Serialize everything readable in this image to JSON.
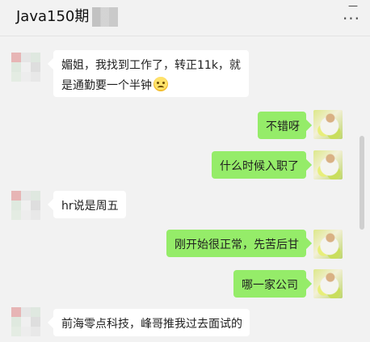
{
  "header": {
    "title": "Java150期",
    "more_label": "···",
    "minimize_label": "—"
  },
  "messages": [
    {
      "side": "left",
      "lines": [
        "媚姐，我找到工作了，转正11k，就",
        "是通勤要一个半钟"
      ],
      "emoji": "crying-face"
    },
    {
      "side": "right",
      "text": "不错呀"
    },
    {
      "side": "right",
      "text": "什么时候入职了"
    },
    {
      "side": "left",
      "text": "hr说是周五"
    },
    {
      "side": "right",
      "text": "刚开始很正常，先苦后甘"
    },
    {
      "side": "right",
      "text": "哪一家公司"
    },
    {
      "side": "left",
      "text": "前海零点科技，峰哥推我过去面试的"
    }
  ],
  "colors": {
    "background": "#f2f2f2",
    "left_bubble": "#ffffff",
    "right_bubble": "#95ec69"
  }
}
